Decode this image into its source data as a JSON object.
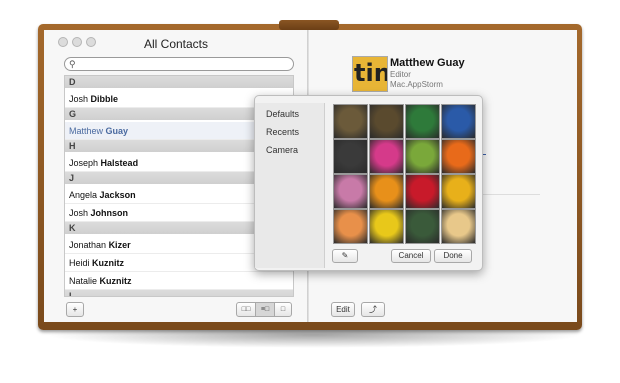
{
  "window": {
    "title": "All Contacts"
  },
  "search": {
    "placeholder": ""
  },
  "contacts": [
    {
      "type": "section",
      "label": "D"
    },
    {
      "type": "contact",
      "first": "Josh",
      "last": "Dibble"
    },
    {
      "type": "section",
      "label": "G"
    },
    {
      "type": "contact",
      "first": "Matthew",
      "last": "Guay",
      "selected": true
    },
    {
      "type": "section",
      "label": "H"
    },
    {
      "type": "contact",
      "first": "Joseph",
      "last": "Halstead"
    },
    {
      "type": "section",
      "label": "J"
    },
    {
      "type": "contact",
      "first": "Angela",
      "last": "Jackson"
    },
    {
      "type": "contact",
      "first": "Josh",
      "last": "Johnson"
    },
    {
      "type": "section",
      "label": "K"
    },
    {
      "type": "contact",
      "first": "Jonathan",
      "last": "Kizer"
    },
    {
      "type": "contact",
      "first": "Heidi",
      "last": "Kuznitz"
    },
    {
      "type": "contact",
      "first": "Natalie",
      "last": "Kuznitz"
    },
    {
      "type": "section",
      "label": "L"
    }
  ],
  "left_toolbar": {
    "add_label": "+"
  },
  "contact_card": {
    "avatar_text": "tin",
    "name": "Matthew Guay",
    "job_title": "Editor",
    "company": "Mac.AppStorm"
  },
  "right_toolbar": {
    "edit_label": "Edit",
    "share_icon": "share-icon"
  },
  "picture_picker": {
    "tabs": [
      "Defaults",
      "Recents",
      "Camera"
    ],
    "tiles": [
      {
        "name": "eagle",
        "color": "#6b5a3a"
      },
      {
        "name": "owl",
        "color": "#5a4a2e"
      },
      {
        "name": "parrot",
        "color": "#2e7a3a"
      },
      {
        "name": "penguin",
        "color": "#2a5aa8"
      },
      {
        "name": "zebra",
        "color": "#3a3a3a"
      },
      {
        "name": "pink-flower",
        "color": "#d53a8a"
      },
      {
        "name": "dandelion",
        "color": "#7aa83a"
      },
      {
        "name": "orange-flower",
        "color": "#e86a1a"
      },
      {
        "name": "lotus",
        "color": "#c87aa8"
      },
      {
        "name": "lily",
        "color": "#e8901a"
      },
      {
        "name": "rose",
        "color": "#c81a2a"
      },
      {
        "name": "sunflower",
        "color": "#e8b01a"
      },
      {
        "name": "peach-rose",
        "color": "#e8904a"
      },
      {
        "name": "daisy",
        "color": "#e8c81a"
      },
      {
        "name": "chalkboard",
        "color": "#3a5a3a"
      },
      {
        "name": "fortune-cookie",
        "color": "#e8c88a"
      }
    ],
    "cancel_label": "Cancel",
    "done_label": "Done"
  }
}
